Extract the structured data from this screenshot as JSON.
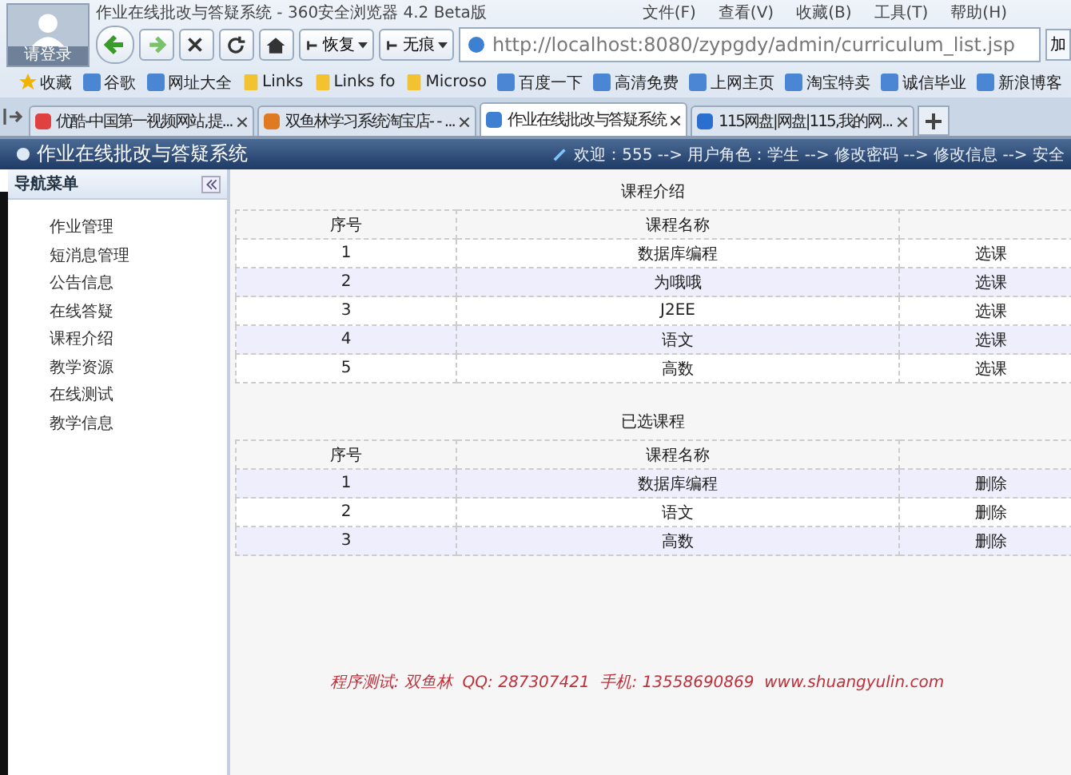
{
  "browser": {
    "avatar_label": "请登录",
    "title": "作业在线批改与答疑系统 - 360安全浏览器 4.2 Beta版",
    "menu": [
      "文件(F)",
      "查看(V)",
      "收藏(B)",
      "工具(T)",
      "帮助(H)"
    ],
    "nav_buttons": [
      {
        "kind": "back"
      },
      {
        "kind": "forward"
      },
      {
        "kind": "stop"
      },
      {
        "kind": "refresh"
      },
      {
        "kind": "home"
      },
      {
        "kind": "restore",
        "label": "恢复"
      },
      {
        "kind": "private",
        "label": "无痕"
      }
    ],
    "address": "http://localhost:8080/zypgdy/admin/curriculum_list.jsp",
    "go_label": "加",
    "bookmarks": [
      {
        "kind": "star",
        "label": "收藏"
      },
      {
        "kind": "site",
        "label": "谷歌"
      },
      {
        "kind": "site",
        "label": "网址大全"
      },
      {
        "kind": "folder",
        "label": "Links"
      },
      {
        "kind": "folder",
        "label": "Links fo"
      },
      {
        "kind": "folder",
        "label": "Microso"
      },
      {
        "kind": "site",
        "label": "百度一下"
      },
      {
        "kind": "site",
        "label": "高清免费"
      },
      {
        "kind": "site",
        "label": "上网主页"
      },
      {
        "kind": "site",
        "label": "淘宝特卖"
      },
      {
        "kind": "site",
        "label": "诚信毕业"
      },
      {
        "kind": "site",
        "label": "新浪博客"
      }
    ],
    "tabs": [
      {
        "label": "优酷-中国第一视频网站,提...",
        "selected": false
      },
      {
        "label": "双鱼林学习系统淘宝店- - ...",
        "selected": false
      },
      {
        "label": "作业在线批改与答疑系统",
        "selected": true
      },
      {
        "label": "115网盘|网盘|115,我的网...",
        "selected": false
      }
    ]
  },
  "page": {
    "title": "作业在线批改与答疑系统",
    "user_nav": "欢迎：555 --> 用户角色：学生 --> 修改密码 --> 修改信息 --> 安全",
    "sidebar": {
      "title": "导航菜单",
      "items": [
        "作业管理",
        "短消息管理",
        "公告信息",
        "在线答疑",
        "课程介绍",
        "教学资源",
        "在线测试",
        "教学信息"
      ]
    },
    "sections": [
      {
        "title": "课程介绍",
        "columns": [
          "序号",
          "课程名称"
        ],
        "rows": [
          {
            "no": "1",
            "name": "数据库编程",
            "action": "选课",
            "shaded": false
          },
          {
            "no": "2",
            "name": "为哦哦",
            "action": "选课",
            "shaded": true
          },
          {
            "no": "3",
            "name": "J2EE",
            "action": "选课",
            "shaded": false
          },
          {
            "no": "4",
            "name": "语文",
            "action": "选课",
            "shaded": true
          },
          {
            "no": "5",
            "name": "高数",
            "action": "选课",
            "shaded": false
          }
        ]
      },
      {
        "title": "已选课程",
        "columns": [
          "序号",
          "课程名称"
        ],
        "rows": [
          {
            "no": "1",
            "name": "数据库编程",
            "action": "删除",
            "shaded": true
          },
          {
            "no": "2",
            "name": "语文",
            "action": "删除",
            "shaded": false
          },
          {
            "no": "3",
            "name": "高数",
            "action": "删除",
            "shaded": true
          }
        ]
      }
    ],
    "footer": "程序测试: 双鱼林  QQ: 287307421  手机: 13558690869  www.shuangyulin.com"
  }
}
